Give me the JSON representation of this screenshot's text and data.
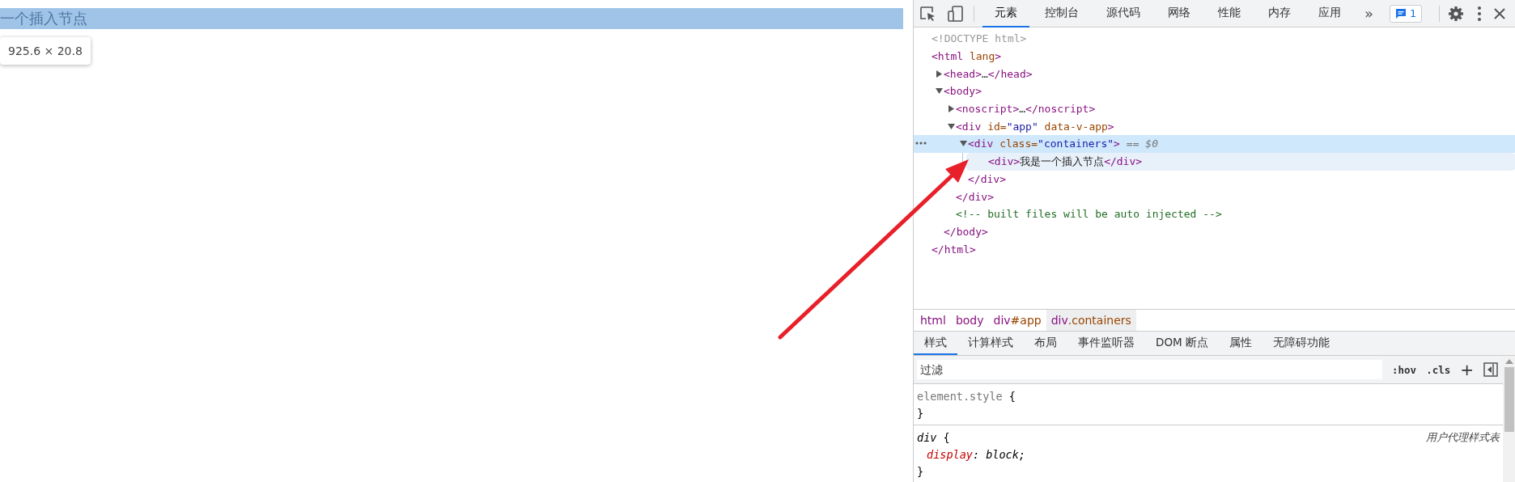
{
  "page": {
    "highlighted_text": "一个插入节点",
    "size_tooltip": "925.6 × 20.8"
  },
  "devtools": {
    "tabs": [
      {
        "label": "元素",
        "selected": true
      },
      {
        "label": "控制台",
        "selected": false
      },
      {
        "label": "源代码",
        "selected": false
      },
      {
        "label": "网络",
        "selected": false
      },
      {
        "label": "性能",
        "selected": false
      },
      {
        "label": "内存",
        "selected": false
      },
      {
        "label": "应用",
        "selected": false
      }
    ],
    "more_tabs": "»",
    "issues_count": "1",
    "dom_tree": [
      {
        "kind": "doctype",
        "text": "<!DOCTYPE html>",
        "selected": false,
        "hovered": false
      },
      {
        "kind": "element",
        "text": "<html lang>",
        "close": "</html>",
        "selected": false,
        "hovered": false,
        "children": [
          {
            "kind": "element",
            "text": "<head>…</head>",
            "expanded": false,
            "selected": false,
            "hovered": false
          },
          {
            "kind": "element",
            "text": "<body>",
            "close": "</body>",
            "expanded": true,
            "selected": false,
            "hovered": false,
            "children": [
              {
                "kind": "element",
                "text": "<noscript>…</noscript>",
                "expanded": false,
                "selected": false,
                "hovered": false
              },
              {
                "kind": "element",
                "text": "<div id=\"app\" data-v-app>",
                "close": "</div>",
                "expanded": true,
                "selected": false,
                "hovered": false,
                "children": [
                  {
                    "kind": "element",
                    "text": "<div class=\"containers\">",
                    "marker": "== $0",
                    "close": "</div>",
                    "expanded": true,
                    "selected": true,
                    "hovered": false,
                    "children": [
                      {
                        "kind": "element",
                        "text": "<div>我是一个插入节点</div>",
                        "selected": false,
                        "hovered": true
                      }
                    ]
                  }
                ]
              },
              {
                "kind": "comment",
                "text": "<!-- built files will be auto injected -->",
                "selected": false,
                "hovered": false
              }
            ]
          }
        ]
      }
    ],
    "breadcrumbs": [
      {
        "label": "html",
        "selected": false
      },
      {
        "label": "body",
        "selected": false
      },
      {
        "label": "div#app",
        "selected": false
      },
      {
        "label": "div.containers",
        "selected": true
      }
    ],
    "sub_tabs": [
      {
        "label": "样式",
        "selected": true
      },
      {
        "label": "计算样式",
        "selected": false
      },
      {
        "label": "布局",
        "selected": false
      },
      {
        "label": "事件监听器",
        "selected": false
      },
      {
        "label": "DOM 断点",
        "selected": false
      },
      {
        "label": "属性",
        "selected": false
      },
      {
        "label": "无障碍功能",
        "selected": false
      }
    ],
    "filter": {
      "placeholder": "过滤",
      "hov": ":hov",
      "cls": ".cls",
      "add": "+"
    },
    "rules": [
      {
        "kind": "inline",
        "selector": "element.style",
        "open": "{",
        "close": "}"
      },
      {
        "kind": "user_agent",
        "selector": "div",
        "open": "{",
        "close": "}",
        "origin": "用户代理样式表",
        "declarations": [
          "display: block;"
        ]
      }
    ]
  }
}
